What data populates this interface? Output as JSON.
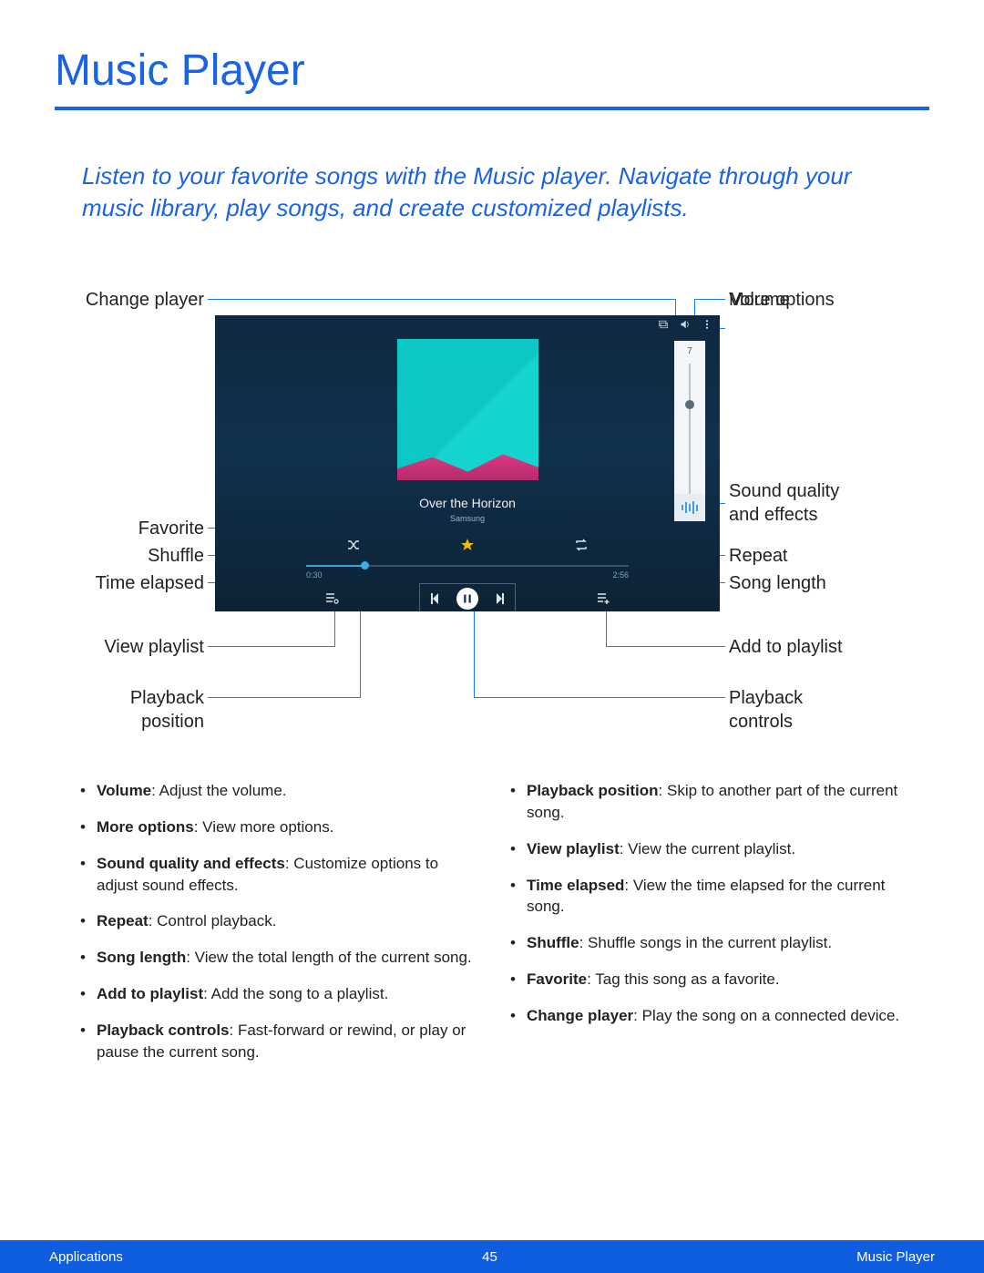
{
  "title": "Music Player",
  "intro": "Listen to your favorite songs with the Music player. Navigate through your music library, play songs, and create customized playlists.",
  "labels": {
    "change_player": "Change player",
    "volume": "Volume",
    "more_options": "More options",
    "sound_quality": "Sound quality\nand effects",
    "favorite": "Favorite",
    "shuffle": "Shuffle",
    "repeat": "Repeat",
    "time_elapsed": "Time elapsed",
    "song_length": "Song length",
    "view_playlist": "View playlist",
    "add_to_playlist": "Add to playlist",
    "playback_position": "Playback\nposition",
    "playback_controls": "Playback\ncontrols"
  },
  "player": {
    "song_title": "Over the Horizon",
    "artist": "Samsung",
    "volume_value": "7",
    "time_elapsed": "0:30",
    "song_length": "2:56"
  },
  "descriptions_left": [
    {
      "term": "Volume",
      "text": ": Adjust the volume."
    },
    {
      "term": "More options",
      "text": ": View more options."
    },
    {
      "term": "Sound quality and effects",
      "text": ": Customize options to adjust sound effects."
    },
    {
      "term": "Repeat",
      "text": ": Control playback."
    },
    {
      "term": "Song length",
      "text": ": View the total length of the current song."
    },
    {
      "term": "Add to playlist",
      "text": ": Add the song to a playlist."
    },
    {
      "term": "Playback controls",
      "text": ": Fast-forward or rewind, or play or pause the current song."
    }
  ],
  "descriptions_right": [
    {
      "term": "Playback position",
      "text": ": Skip to another part of the current song."
    },
    {
      "term": "View playlist",
      "text": ": View the current playlist."
    },
    {
      "term": "Time elapsed",
      "text": ": View the time elapsed for the current song."
    },
    {
      "term": "Shuffle",
      "text": ": Shuffle songs in the current playlist."
    },
    {
      "term": "Favorite",
      "text": ": Tag this song as a favorite."
    },
    {
      "term": "Change player",
      "text": ": Play the song on a connected device."
    }
  ],
  "footer": {
    "left": "Applications",
    "center": "45",
    "right": "Music Player"
  }
}
